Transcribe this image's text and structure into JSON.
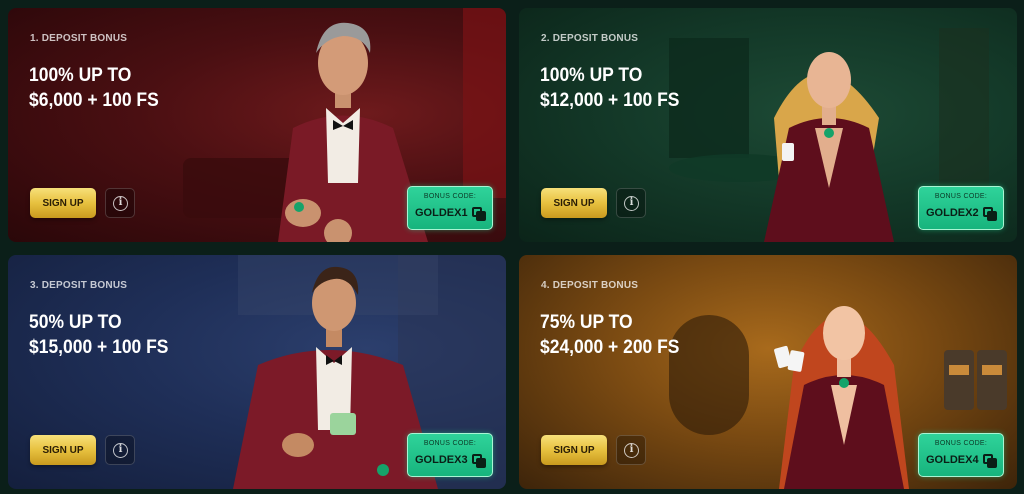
{
  "cards": [
    {
      "label": "1. DEPOSIT BONUS",
      "title_line1": "100% UP TO",
      "title_line2": "$6,000 + 100 FS",
      "signup_label": "SIGN UP",
      "info_glyph": "i",
      "code_label": "BONUS CODE:",
      "code_value": "GOLDEX1"
    },
    {
      "label": "2. DEPOSIT BONUS",
      "title_line1": "100% UP TO",
      "title_line2": "$12,000 + 100 FS",
      "signup_label": "SIGN UP",
      "info_glyph": "i",
      "code_label": "BONUS CODE:",
      "code_value": "GOLDEX2"
    },
    {
      "label": "3. DEPOSIT BONUS",
      "title_line1": "50% UP TO",
      "title_line2": "$15,000 + 100 FS",
      "signup_label": "SIGN UP",
      "info_glyph": "i",
      "code_label": "BONUS CODE:",
      "code_value": "GOLDEX3"
    },
    {
      "label": "4. DEPOSIT BONUS",
      "title_line1": "75% UP TO",
      "title_line2": "$24,000 + 200 FS",
      "signup_label": "SIGN UP",
      "info_glyph": "i",
      "code_label": "BONUS CODE:",
      "code_value": "GOLDEX4"
    }
  ],
  "colors": {
    "page_bg": "#0b1f19",
    "card1_bg": "#4a0f12",
    "card2_bg": "#143a29",
    "card3_bg": "#1f2f58",
    "card4_bg": "#7a4a12",
    "signup_button": "#e7c13f",
    "code_badge": "#1fbf86"
  },
  "icons": {
    "info": "info-icon",
    "copy": "copy-icon"
  }
}
